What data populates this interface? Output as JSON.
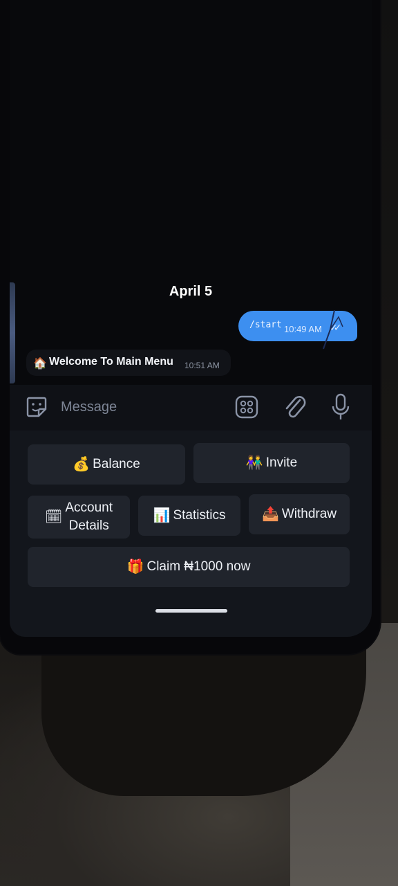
{
  "chat": {
    "date": "April 5",
    "outgoing": {
      "text": "/start",
      "time": "10:49 AM",
      "ticks": "✓✓"
    },
    "incoming": {
      "icon": "🏠",
      "text": "Welcome To Main Menu",
      "time": "10:51 AM"
    }
  },
  "input": {
    "placeholder": "Message",
    "icons": [
      "sticker-icon",
      "bot-menu-icon",
      "attach-icon",
      "mic-icon"
    ]
  },
  "keyboard": {
    "balance": {
      "emoji": "💰",
      "label": "Balance"
    },
    "invite": {
      "emoji": "👫",
      "label": "Invite"
    },
    "account_details": {
      "emoji": "🗓",
      "label_line1": "Account",
      "label_line2": "Details"
    },
    "statistics": {
      "emoji": "📊",
      "label": "Statistics"
    },
    "withdraw": {
      "emoji": "📤",
      "label": "Withdraw"
    },
    "claim": {
      "emoji": "🎁",
      "label": "Claim ₦1000 now"
    }
  },
  "colors": {
    "outgoing_bubble": "#3d8ff0",
    "keyboard_button": "#20242c",
    "screen_bg": "#08090c"
  }
}
